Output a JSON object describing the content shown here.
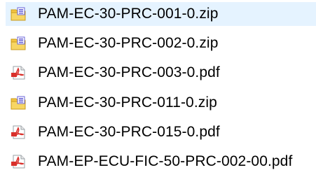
{
  "files": [
    {
      "name": "PAM-EC-30-PRC-001-0.zip",
      "icon": "zip-folder-icon",
      "selected": true
    },
    {
      "name": "PAM-EC-30-PRC-002-0.zip",
      "icon": "zip-folder-icon",
      "selected": false
    },
    {
      "name": "PAM-EC-30-PRC-003-0.pdf",
      "icon": "pdf-file-icon",
      "selected": false
    },
    {
      "name": "PAM-EC-30-PRC-011-0.zip",
      "icon": "zip-folder-icon",
      "selected": false
    },
    {
      "name": "PAM-EC-30-PRC-015-0.pdf",
      "icon": "pdf-file-icon",
      "selected": false
    },
    {
      "name": "PAM-EP-ECU-FIC-50-PRC-002-00.pdf",
      "icon": "pdf-file-icon",
      "selected": false
    }
  ],
  "colors": {
    "selection_background": "#e5f3ff",
    "zip_folder_yellow": "#f4c542",
    "zip_tag_purple": "#6a63d8",
    "pdf_red": "#d9302b"
  }
}
